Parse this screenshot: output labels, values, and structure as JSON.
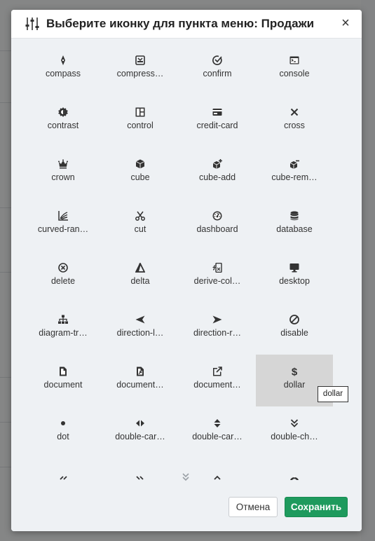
{
  "dialog": {
    "title": "Выберите иконку для пункта меню: Продажи",
    "close_symbol": "×"
  },
  "icons": [
    {
      "label": "compass",
      "icon": "compass-icon"
    },
    {
      "label": "compress…",
      "icon": "compress-icon"
    },
    {
      "label": "confirm",
      "icon": "confirm-icon"
    },
    {
      "label": "console",
      "icon": "console-icon"
    },
    {
      "label": "contrast",
      "icon": "contrast-icon"
    },
    {
      "label": "control",
      "icon": "control-icon"
    },
    {
      "label": "credit-card",
      "icon": "credit-card-icon"
    },
    {
      "label": "cross",
      "icon": "cross-icon"
    },
    {
      "label": "crown",
      "icon": "crown-icon"
    },
    {
      "label": "cube",
      "icon": "cube-icon"
    },
    {
      "label": "cube-add",
      "icon": "cube-add-icon"
    },
    {
      "label": "cube-rem…",
      "icon": "cube-remove-icon"
    },
    {
      "label": "curved-ran…",
      "icon": "curved-range-icon"
    },
    {
      "label": "cut",
      "icon": "cut-icon"
    },
    {
      "label": "dashboard",
      "icon": "dashboard-icon"
    },
    {
      "label": "database",
      "icon": "database-icon"
    },
    {
      "label": "delete",
      "icon": "delete-icon"
    },
    {
      "label": "delta",
      "icon": "delta-icon"
    },
    {
      "label": "derive-col…",
      "icon": "derive-column-icon"
    },
    {
      "label": "desktop",
      "icon": "desktop-icon"
    },
    {
      "label": "diagram-tr…",
      "icon": "diagram-tree-icon"
    },
    {
      "label": "direction-l…",
      "icon": "direction-left-icon"
    },
    {
      "label": "direction-r…",
      "icon": "direction-right-icon"
    },
    {
      "label": "disable",
      "icon": "disable-icon"
    },
    {
      "label": "document",
      "icon": "document-icon"
    },
    {
      "label": "document…",
      "icon": "document-open-icon"
    },
    {
      "label": "document…",
      "icon": "document-share-icon"
    },
    {
      "label": "dollar",
      "icon": "dollar-icon",
      "selected": true
    },
    {
      "label": "dot",
      "icon": "dot-icon"
    },
    {
      "label": "double-car…",
      "icon": "double-caret-horizontal-icon"
    },
    {
      "label": "double-car…",
      "icon": "double-caret-vertical-icon"
    },
    {
      "label": "double-ch…",
      "icon": "double-chevron-down-icon"
    },
    {
      "label": "",
      "icon": "double-chevron-left-icon"
    },
    {
      "label": "",
      "icon": "double-chevron-right-icon"
    },
    {
      "label": "",
      "icon": "double-chevron-up-icon"
    },
    {
      "label": "",
      "icon": "doughnut-chart-icon"
    }
  ],
  "tooltip": {
    "text": "dollar"
  },
  "footer": {
    "cancel_label": "Отмена",
    "save_label": "Сохранить"
  },
  "colors": {
    "save_button": "#1e9a5d",
    "selected_cell": "#d6d6d6",
    "icon": "#333333"
  }
}
